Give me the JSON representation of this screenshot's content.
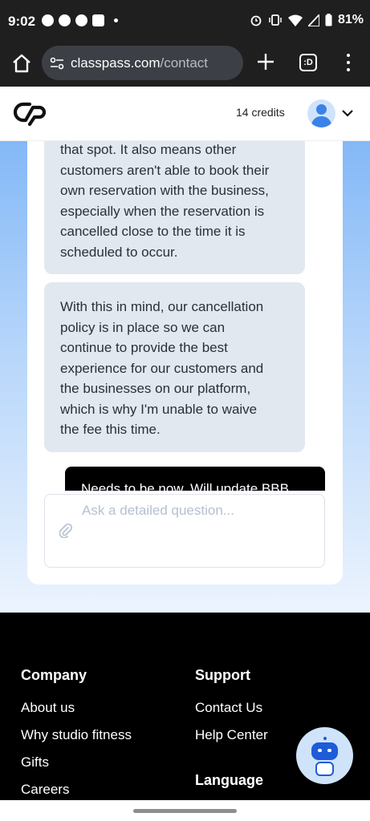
{
  "status_bar": {
    "time": "9:02",
    "battery": "81%"
  },
  "browser": {
    "url_host": "classpass.com",
    "url_path": "/contact",
    "tabs_label": ":D"
  },
  "header": {
    "credits": "14 credits"
  },
  "chat": {
    "messages": [
      {
        "role": "agent",
        "lines": [
          "that spot. It also means other",
          "customers aren't able to book their",
          "own reservation with the business,",
          "especially when the reservation is",
          "cancelled close to the time it is",
          "scheduled to occur."
        ]
      },
      {
        "role": "agent",
        "lines": [
          "With this in mind, our cancellation",
          "policy is in place so we can",
          "continue to provide the best",
          "experience for our customers and",
          "the businesses on our platform,",
          "which is why I'm unable to waive",
          "the fee this time."
        ]
      },
      {
        "role": "user",
        "text": "Needs to be now. Will update BBB"
      }
    ],
    "input_placeholder": "Ask a detailed question..."
  },
  "footer": {
    "company_title": "Company",
    "company_links": [
      "About us",
      "Why studio fitness",
      "Gifts",
      "Careers"
    ],
    "support_title": "Support",
    "support_links": [
      "Contact Us",
      "Help Center"
    ],
    "language_title": "Language"
  },
  "colors": {
    "accent": "#1e5bd8",
    "bubble": "#e2e8f0",
    "gradient_top": "#84b8f7"
  }
}
